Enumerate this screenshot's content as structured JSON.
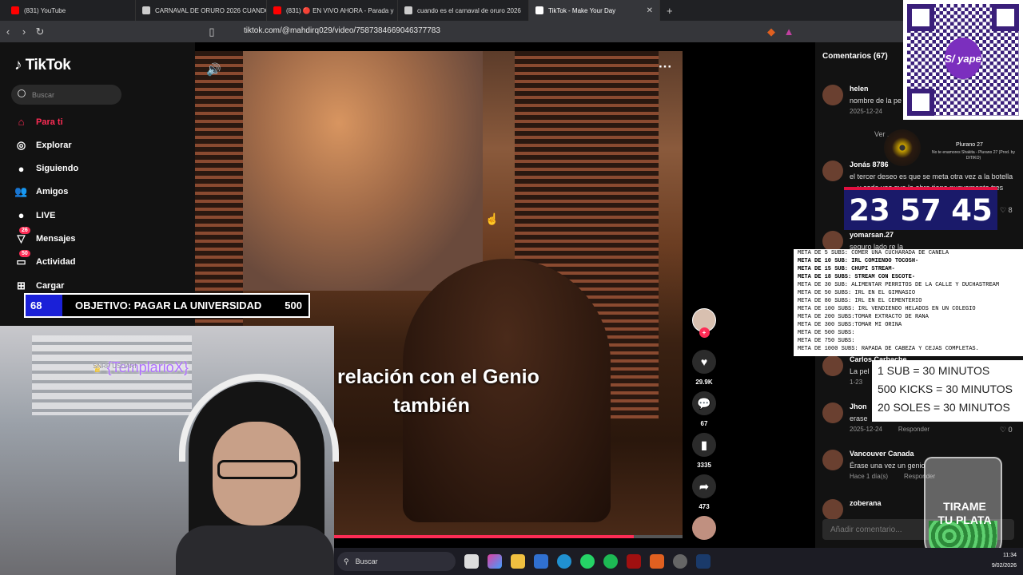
{
  "browser": {
    "tabs": [
      {
        "title": "(831) YouTube",
        "color": "#ff0000"
      },
      {
        "title": "CARNAVAL DE ORURO 2026 CUANDO...",
        "color": "#cccccc"
      },
      {
        "title": "(831) 🔴 EN VIVO AHORA - Parada y",
        "color": "#ff0000"
      },
      {
        "title": "cuando es el carnaval de oruro 2026",
        "color": "#cccccc"
      },
      {
        "title": "TikTok - Make Your Day",
        "color": "#ffffff"
      }
    ],
    "new_tab": "+",
    "url": "tiktok.com/@mahdirq029/video/7587384669046377783"
  },
  "tiktok": {
    "logo": "TikTok",
    "search_placeholder": "Buscar",
    "nav": [
      {
        "label": "Para ti",
        "icon": "home-icon",
        "active": true
      },
      {
        "label": "Explorar",
        "icon": "compass-icon"
      },
      {
        "label": "Siguiendo",
        "icon": "following-icon"
      },
      {
        "label": "Amigos",
        "icon": "friends-icon"
      },
      {
        "label": "LIVE",
        "icon": "live-icon"
      },
      {
        "label": "Mensajes",
        "icon": "messages-icon",
        "badge": "26"
      },
      {
        "label": "Actividad",
        "icon": "activity-icon",
        "badge": "50"
      },
      {
        "label": "Cargar",
        "icon": "upload-icon"
      }
    ],
    "video": {
      "caption_line1": "relación con el Genio",
      "caption_line2": "también",
      "progress": 0.9
    },
    "actions": {
      "likes": "29.9K",
      "comments": "67",
      "saves": "3335",
      "shares": "473"
    },
    "comments_title": "Comentarios (67)",
    "comments": [
      {
        "name": "helen",
        "text": "nombre de la pe",
        "date": "2025-12-24"
      },
      {
        "view_replies": "Ver ... as"
      },
      {
        "name": "Jonás 8786",
        "text": "el tercer deseo es que se meta otra vez a la botella ....y cada vez que la abra tiene nuevamente tres deseos jajajaja",
        "date": "2025-12-24",
        "reply": "Responder",
        "likes": "8"
      },
      {
        "name": "yomarsan.27",
        "text": "seguro lado re la"
      },
      {
        "name": "Carlos Carbache",
        "text": "La pel",
        "date": "1-23"
      },
      {
        "name": "Jhon",
        "text": "erase",
        "date": "2025-12-24",
        "reply": "Responder",
        "likes": "0"
      },
      {
        "name": "Vancouver Canada",
        "text": "Érase una vez un genio",
        "date": "Hace 1 día(s)",
        "reply": "Responder"
      },
      {
        "name": "zoberana",
        "text": ""
      }
    ],
    "add_comment_placeholder": "Añadir comentario..."
  },
  "overlays": {
    "qr_label": "S/ yape",
    "song": {
      "artist_art": "CHAYITA",
      "title": "Plurano 27",
      "subtitle": "No te enamores Shakita - Plurano 27 (Prod. by DITIKO)"
    },
    "score": {
      "a": "23",
      "b": "57",
      "c": "45"
    },
    "goals": [
      {
        "text": "META DE 5 SUBS: COMER UNA CUCHARADA DE CANELA",
        "bold": false
      },
      {
        "text": "META DE 10 SUB: IRL COMIENDO TOCOSH-",
        "bold": true
      },
      {
        "text": "META DE 15 SUB: CHUPI STREAM-",
        "bold": true
      },
      {
        "text": "META DE 18 SUBS: STREAM CON ESCOTE-",
        "bold": true
      },
      {
        "text": "META DE 30 SUB:  ALIMENTAR PERRITOS DE LA CALLE Y DUCHASTREAM",
        "bold": false
      },
      {
        "text": "META DE 50 SUBS: IRL EN EL GIMNASIO",
        "bold": false
      },
      {
        "text": "META DE 80 SUBS: IRL EN EL CEMENTERIO",
        "bold": false
      },
      {
        "text": "META DE 100 SUBS: IRL VENDIENDO HELADOS EN UN COLEGIO",
        "bold": false
      },
      {
        "text": "META DE 200 SUBS:TOMAR EXTRACTO DE RANA",
        "bold": false
      },
      {
        "text": "META DE 300 SUBS:TOMAR MI ORINA",
        "bold": false
      },
      {
        "text": "META DE 500 SUBS:",
        "bold": false
      },
      {
        "text": "META DE 750 SUBS:",
        "bold": false
      },
      {
        "text": "META DE 1000 SUBS: RAPADA DE CABEZA Y CEJAS COMPLETAS.",
        "bold": false
      }
    ],
    "rates": [
      "1 SUB = 30 MINUTOS",
      "500 KICKS = 30 MINUTOS",
      "20 SOLES = 30 MINUTOS"
    ],
    "jar_label_1": "TIRAME",
    "jar_label_2": "TU PLATA",
    "objective": {
      "current": "68",
      "text": "OBJETIVO: PAGAR LA UNIVERSIDAD",
      "goal": "500"
    },
    "chat_name": "{TemplarioX}",
    "chat_small": "SNRP USUARI"
  },
  "taskbar": {
    "search": "Buscar",
    "time": "11:34",
    "date": "9/02/2026"
  }
}
